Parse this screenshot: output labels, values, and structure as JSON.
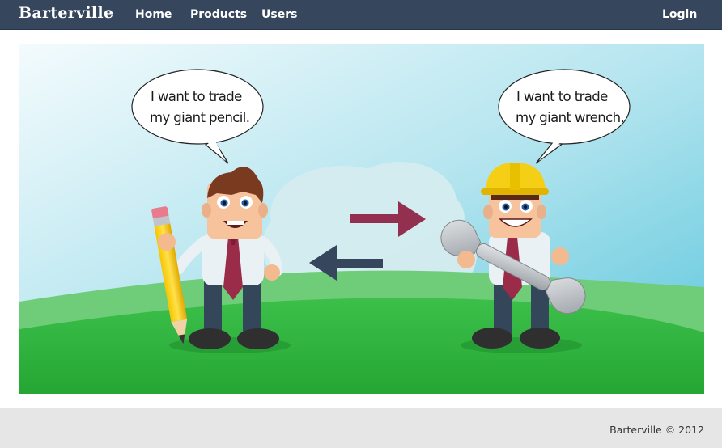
{
  "navbar": {
    "brand": "Barterville",
    "links": [
      {
        "label": "Home"
      },
      {
        "label": "Products"
      },
      {
        "label": "Users"
      }
    ],
    "login_label": "Login"
  },
  "hero": {
    "left_speech": [
      "I want to trade",
      "my giant pencil."
    ],
    "right_speech": [
      "I want to trade",
      "my giant wrench."
    ],
    "colors": {
      "sky_top": "#eaf7fb",
      "sky_bottom": "#6ccde0",
      "grass": "#2eb23f",
      "arrow_right": "#94304f",
      "arrow_left": "#36465d"
    }
  },
  "footer": {
    "text": "Barterville © 2012"
  }
}
